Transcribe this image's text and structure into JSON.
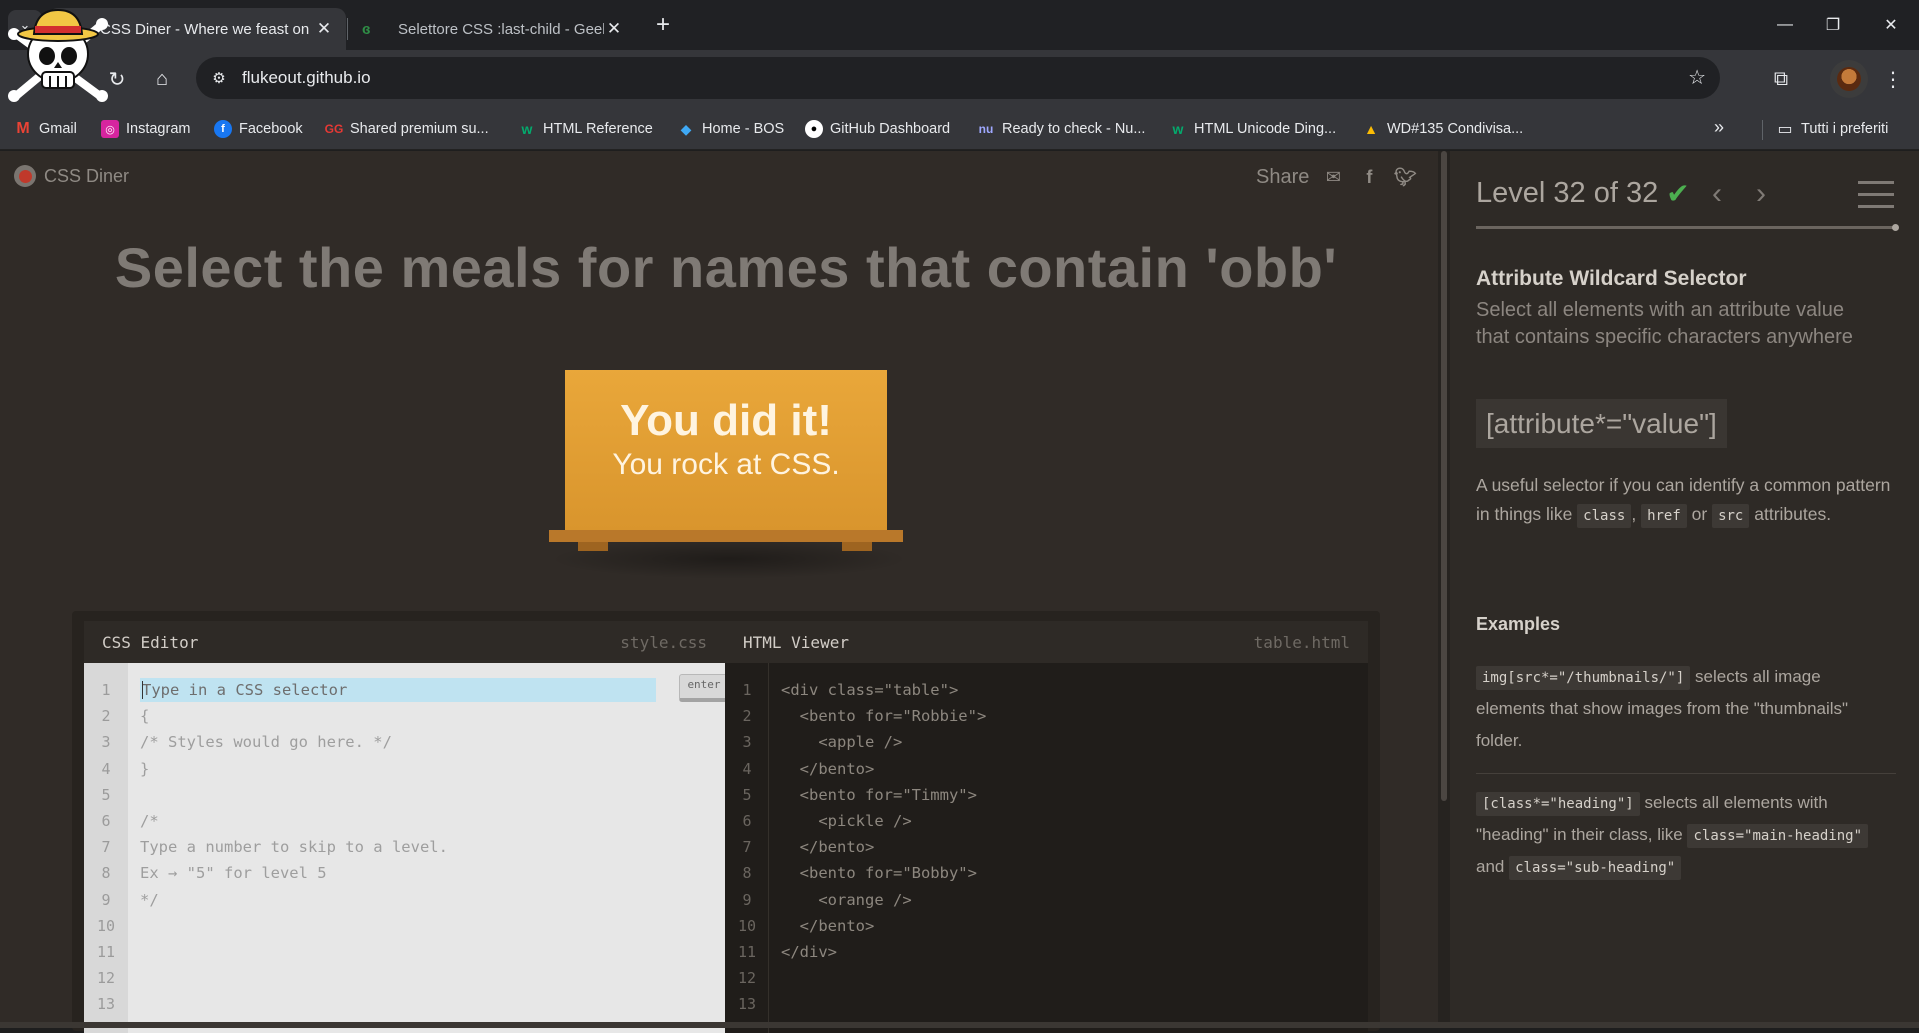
{
  "browser": {
    "tabs": [
      {
        "title": "CSS Diner - Where we feast on CSS",
        "active": true
      },
      {
        "title": "Selettore CSS :last-child - GeeksforGeeks",
        "active": false
      }
    ],
    "tab_list_icon": "chevron-down-icon",
    "new_tab_icon": "plus-icon",
    "address": "flukeout.github.io",
    "bookmarks": [
      {
        "label": "Gmail",
        "icon": "gmail-icon",
        "color": "#ea4335"
      },
      {
        "label": "Instagram",
        "icon": "instagram-icon",
        "color": "#d6249f"
      },
      {
        "label": "Facebook",
        "icon": "facebook-icon",
        "color": "#1877f2"
      },
      {
        "label": "Shared premium su...",
        "icon": "gg-icon",
        "color": "#e53935"
      },
      {
        "label": "HTML Reference",
        "icon": "w3-icon",
        "color": "#04aa6d"
      },
      {
        "label": "Home - BOS",
        "icon": "diamond-icon",
        "color": "#3fa9f5"
      },
      {
        "label": "GitHub Dashboard",
        "icon": "github-icon",
        "color": "#ffffff"
      },
      {
        "label": "Ready to check - Nu...",
        "icon": "nu-icon",
        "color": "#7b61ff"
      },
      {
        "label": "HTML Unicode Ding...",
        "icon": "w3-icon",
        "color": "#04aa6d"
      },
      {
        "label": "WD#135 Condivisa...",
        "icon": "drive-icon",
        "color": "#fbbc04"
      }
    ],
    "all_bookmarks": "Tutti i preferiti"
  },
  "page": {
    "brand": "CSS Diner",
    "share_label": "Share",
    "order_title": "Select the meals for names that contain 'obb'",
    "win_line1": "You did it!",
    "win_line2": "You rock at CSS.",
    "css_editor": {
      "title": "CSS Editor",
      "file": "style.css",
      "placeholder": "Type in a CSS selector",
      "enter_label": "enter",
      "line_numbers": [
        "1",
        "2",
        "3",
        "4",
        "5",
        "6",
        "7",
        "8",
        "9",
        "10",
        "11",
        "12",
        "13"
      ],
      "code_lines": [
        "",
        "{",
        "/* Styles would go here. */",
        "}",
        "",
        "/*",
        "Type a number to skip to a level.",
        "Ex → \"5\" for level 5",
        "*/",
        "",
        "",
        "",
        ""
      ]
    },
    "html_viewer": {
      "title": "HTML Viewer",
      "file": "table.html",
      "line_numbers": [
        "1",
        "2",
        "3",
        "4",
        "5",
        "6",
        "7",
        "8",
        "9",
        "10",
        "11",
        "12",
        "13"
      ],
      "code_lines": [
        "<div class=\"table\">",
        "  <bento for=\"Robbie\">",
        "    <apple />",
        "  </bento>",
        "  <bento for=\"Timmy\">",
        "    <pickle />",
        "  </bento>",
        "  <bento for=\"Bobby\">",
        "    <orange />",
        "  </bento>",
        "</div>",
        "",
        ""
      ]
    }
  },
  "sidebar": {
    "level": "Level 32 of 32",
    "level_complete": true,
    "progress": 1.0,
    "selector_name": "Attribute Wildcard Selector",
    "selector_title": "Select all elements with an attribute value that contains specific characters anywhere",
    "syntax": "[attribute*=\"value\"]",
    "hint_before": "A useful selector if you can identify a common pattern in things like ",
    "hint_chip1": "class",
    "hint_mid1": ", ",
    "hint_chip2": "href",
    "hint_mid2": " or ",
    "hint_chip3": "src",
    "hint_after": " attributes.",
    "examples_heading": "Examples",
    "example1_code": "img[src*=\"/thumbnails/\"]",
    "example1_text": " selects all image elements that show images from the \"thumbnails\" folder.",
    "example2_code": "[class*=\"heading\"]",
    "example2_text1": " selects all elements with \"heading\" in their class, like ",
    "example2_code2": "class=\"main-heading\"",
    "example2_text2": " and ",
    "example2_code3": "class=\"sub-heading\""
  },
  "colors": {
    "accent_check": "#4caf50",
    "table": "#e9a73a",
    "input_highlight": "#bfe3f1"
  }
}
